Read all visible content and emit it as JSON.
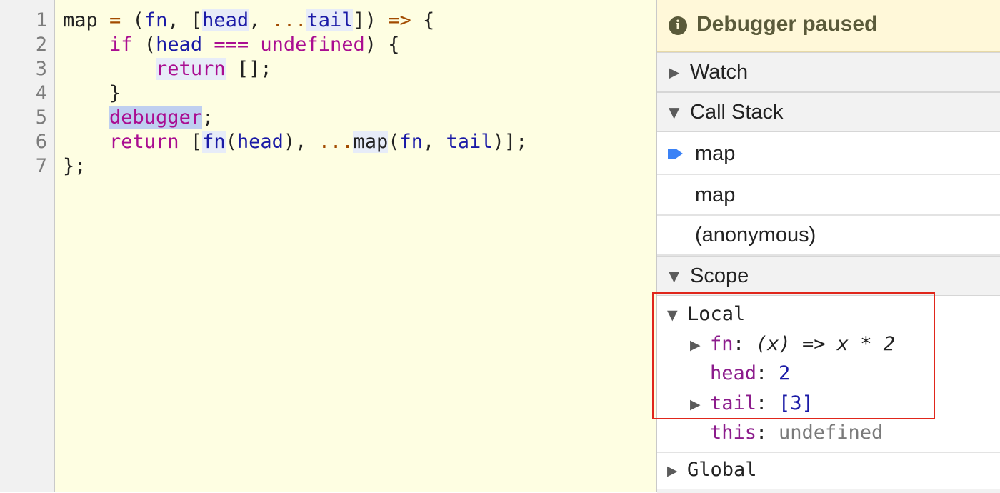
{
  "editor": {
    "line_numbers": [
      "1",
      "2",
      "3",
      "4",
      "5",
      "6",
      "7"
    ]
  },
  "sidebar": {
    "paused_label": "Debugger paused",
    "sections": {
      "watch": "Watch",
      "call_stack": "Call Stack",
      "scope": "Scope"
    },
    "call_stack_frames": [
      "map",
      "map",
      "(anonymous)"
    ],
    "scope": {
      "local_label": "Local",
      "fn_key": "fn",
      "fn_value": "(x) => x * 2",
      "head_key": "head",
      "head_value": "2",
      "tail_key": "tail",
      "tail_value": "[3]",
      "this_key": "this",
      "this_value": "undefined",
      "global_label": "Global"
    }
  }
}
